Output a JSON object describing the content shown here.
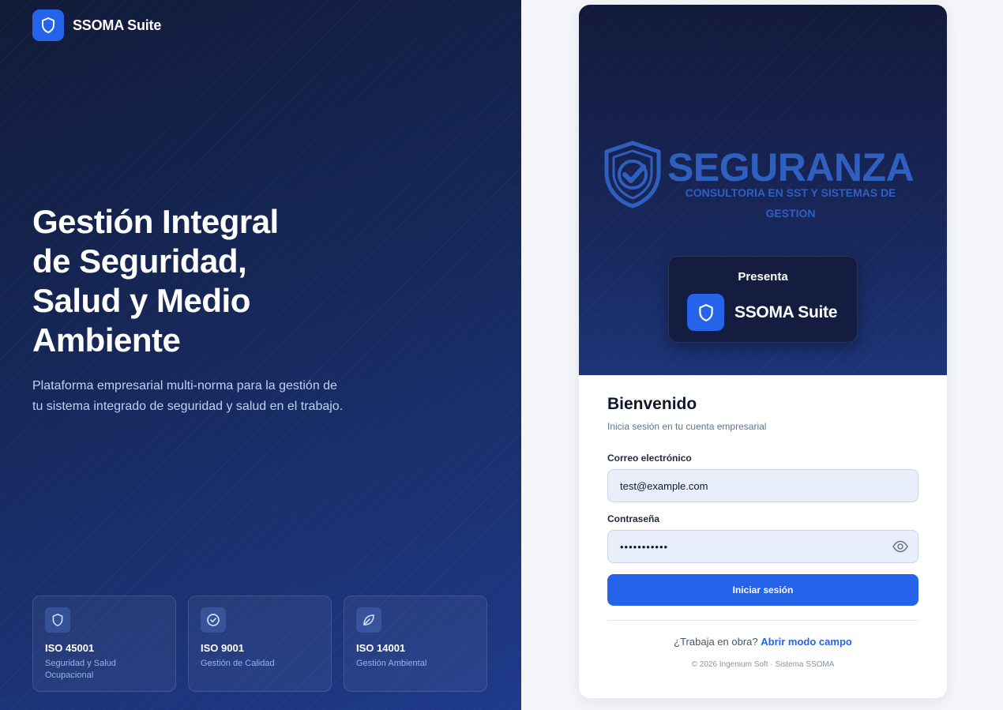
{
  "brand": {
    "name": "SSOMA Suite",
    "icon": "shield-icon"
  },
  "hero": {
    "title_lines": [
      "Gestión Integral",
      "de Seguridad,",
      "Salud y Medio",
      "Ambiente"
    ],
    "subtitle": "Plataforma empresarial multi-norma para la gestión de tu sistema integrado de seguridad y salud en el trabajo."
  },
  "iso_cards": [
    {
      "icon": "shield-icon",
      "title": "ISO 45001",
      "desc_lines": [
        "Seguridad y Salud",
        "Ocupacional"
      ]
    },
    {
      "icon": "check-circle-icon",
      "title": "ISO 9001",
      "desc_lines": [
        "Gestión de Calidad"
      ]
    },
    {
      "icon": "leaf-icon",
      "title": "ISO 14001",
      "desc_lines": [
        "Gestión Ambiental"
      ]
    }
  ],
  "partner_logo": {
    "word": "SEGURANZA",
    "tagline_lines": [
      "CONSULTORIA EN SST Y SISTEMAS DE",
      "GESTION"
    ]
  },
  "presenta": {
    "label": "Presenta",
    "name": "SSOMA Suite"
  },
  "login": {
    "title": "Bienvenido",
    "subtitle": "Inicia sesión en tu cuenta empresarial",
    "email_label": "Correo electrónico",
    "email_value": "test@example.com",
    "password_label": "Contraseña",
    "password_value": "•••••••••••",
    "submit_label": "Iniciar sesión",
    "field_question": "¿Trabaja en obra?",
    "field_link": "Abrir modo campo",
    "copyright": "© 2026 Ingenium Soft · Sistema SSOMA"
  },
  "colors": {
    "accent": "#2563eb",
    "navy": "#16285a",
    "logo_blue": "#2f5fbf"
  }
}
